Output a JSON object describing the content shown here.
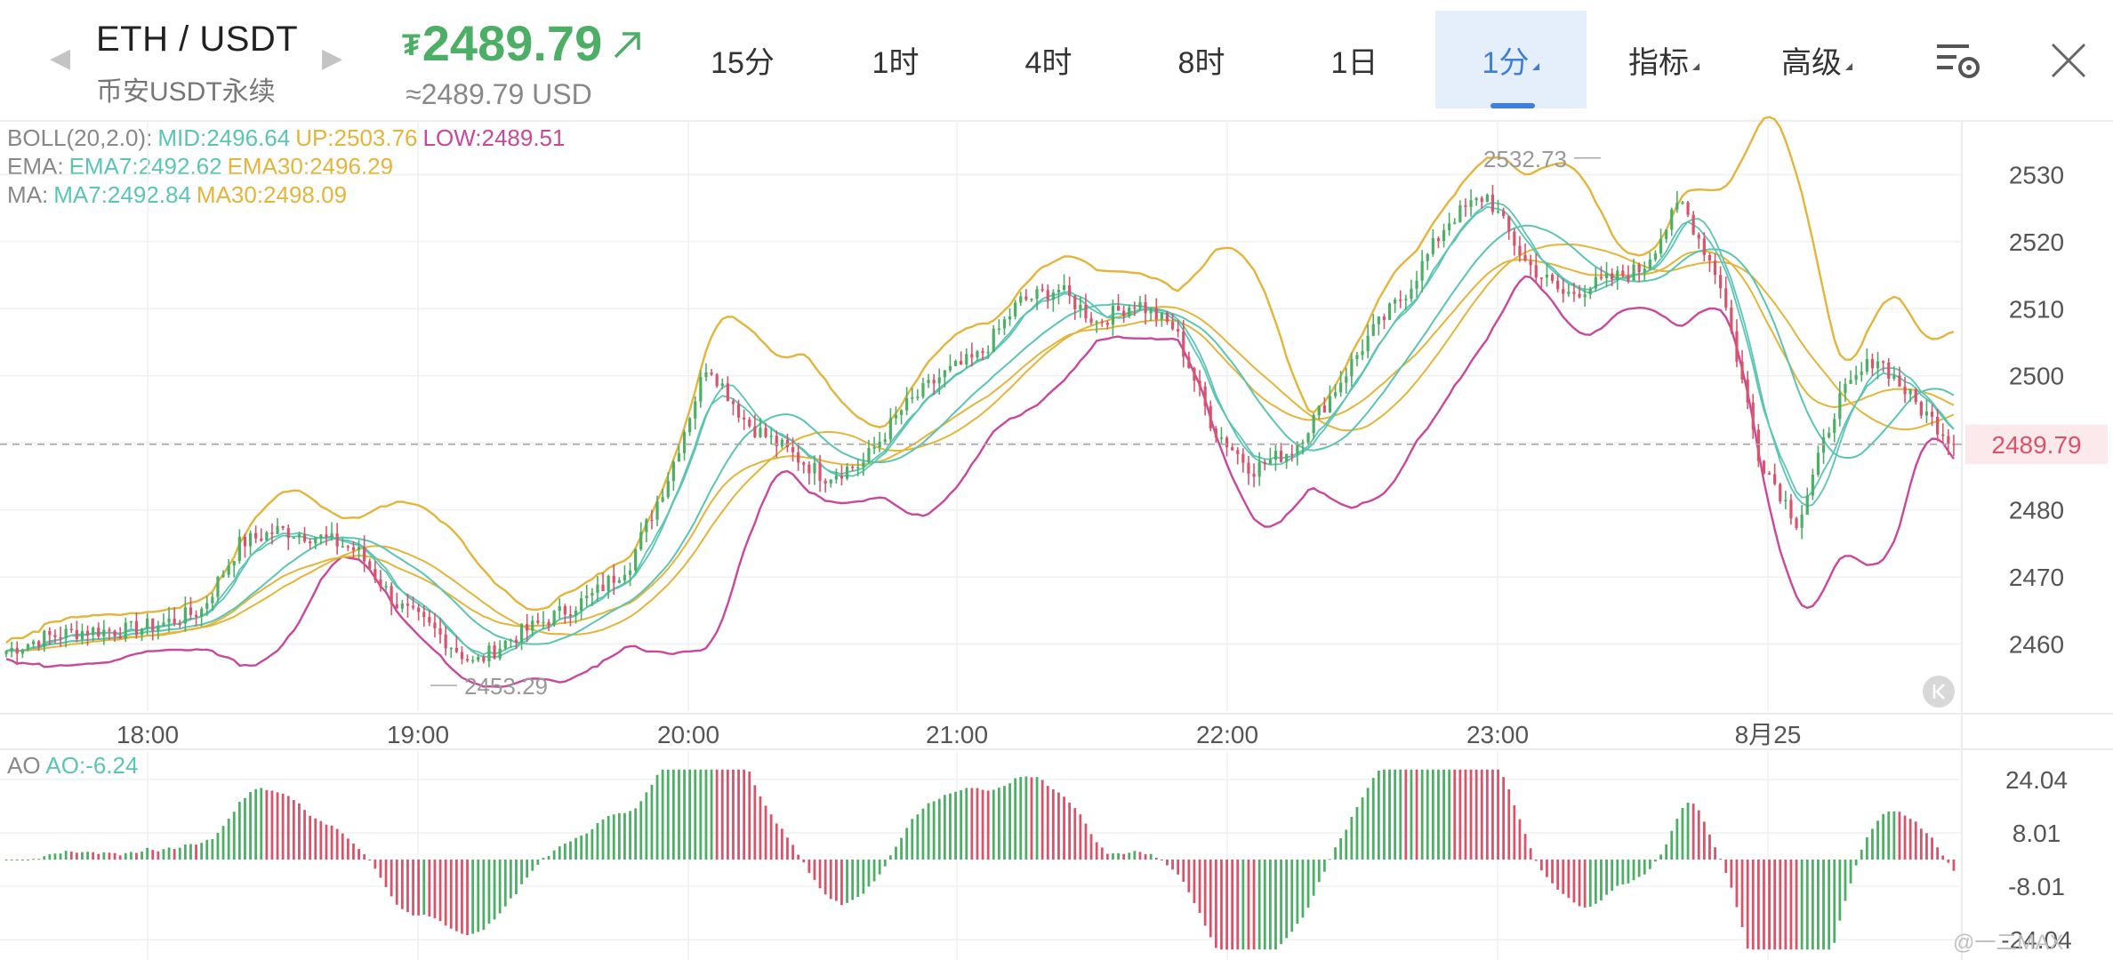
{
  "header": {
    "pair": "ETH / USDT",
    "exchange": "币安USDT永续",
    "currency_symbol": "₮",
    "price": "2489.79",
    "price_usd": "≈2489.79 USD",
    "prev_arrow": "◀",
    "next_arrow": "▶"
  },
  "tabs": [
    {
      "label": "15分",
      "active": false,
      "dropdown": false
    },
    {
      "label": "1时",
      "active": false,
      "dropdown": false
    },
    {
      "label": "4时",
      "active": false,
      "dropdown": false
    },
    {
      "label": "8时",
      "active": false,
      "dropdown": false
    },
    {
      "label": "1日",
      "active": false,
      "dropdown": false
    },
    {
      "label": "1分",
      "active": true,
      "dropdown": true
    },
    {
      "label": "指标",
      "active": false,
      "dropdown": true
    },
    {
      "label": "高级",
      "active": false,
      "dropdown": true
    }
  ],
  "icons": {
    "settings": "chart-settings-icon",
    "close": "close-icon"
  },
  "legend": {
    "boll": {
      "name": "BOLL(20,2.0):",
      "mid": "MID:2496.64",
      "up": "UP:2503.76",
      "low": "LOW:2489.51"
    },
    "ema": {
      "name": "EMA:",
      "ema7": "EMA7:2492.62",
      "ema30": "EMA30:2496.29"
    },
    "ma": {
      "name": "MA:",
      "ma7": "MA7:2492.84",
      "ma30": "MA30:2498.09"
    }
  },
  "ao_legend": {
    "name": "AO",
    "value": "AO:-6.24"
  },
  "watermark": "@一二MAX",
  "colors": {
    "up": "#4caf65",
    "down": "#d9546b",
    "mid": "#5bc5b4",
    "boll_up": "#e3b53a",
    "boll_low": "#c9489c",
    "ema7": "#5bc5b4",
    "ema30": "#e3b53a",
    "last_price": "#d9546b",
    "active_tab": "#3d7fd9",
    "grid": "#f0f0f0"
  },
  "chart_data": [
    {
      "type": "candlestick",
      "title": "",
      "x_ticks": [
        "18:00",
        "19:00",
        "20:00",
        "21:00",
        "22:00",
        "23:00",
        "8月25"
      ],
      "y_ticks": [
        2460,
        2470,
        2480,
        2490,
        2500,
        2510,
        2520,
        2530
      ],
      "ylim": [
        2450,
        2538
      ],
      "last_price": 2489.79,
      "last_price_label": "2489.79",
      "annotations": [
        {
          "label": "2532.73",
          "value": 2532.73,
          "kind": "high"
        },
        {
          "label": "2453.29",
          "value": 2453.29,
          "kind": "low"
        }
      ],
      "close_keypoints": [
        2459,
        2461,
        2462,
        2462,
        2463,
        2465,
        2475,
        2477,
        2476,
        2474,
        2466,
        2462,
        2457,
        2461,
        2464,
        2467,
        2472,
        2485,
        2502,
        2493,
        2489,
        2485,
        2487,
        2495,
        2500,
        2503,
        2511,
        2513,
        2508,
        2511,
        2507,
        2492,
        2486,
        2489,
        2497,
        2506,
        2513,
        2523,
        2527,
        2517,
        2512,
        2514,
        2516,
        2526,
        2514,
        2488,
        2478,
        2496,
        2503,
        2496,
        2490
      ],
      "series": [
        {
          "name": "MID",
          "color": "#5bc5b4"
        },
        {
          "name": "UP",
          "color": "#e3b53a"
        },
        {
          "name": "LOW",
          "color": "#c9489c"
        },
        {
          "name": "EMA7",
          "color": "#5bc5b4"
        },
        {
          "name": "EMA30",
          "color": "#e3b53a"
        },
        {
          "name": "MA7",
          "color": "#5bc5b4"
        },
        {
          "name": "MA30",
          "color": "#e3b53a"
        }
      ]
    },
    {
      "type": "bar",
      "name": "AO",
      "y_ticks": [
        24.04,
        8.01,
        -8.01,
        -24.04
      ],
      "y_tick_labels": [
        "24.04",
        "8.01",
        "-8.01",
        "-24.04"
      ],
      "ylim": [
        -28,
        28
      ],
      "last_value": -6.24
    }
  ]
}
